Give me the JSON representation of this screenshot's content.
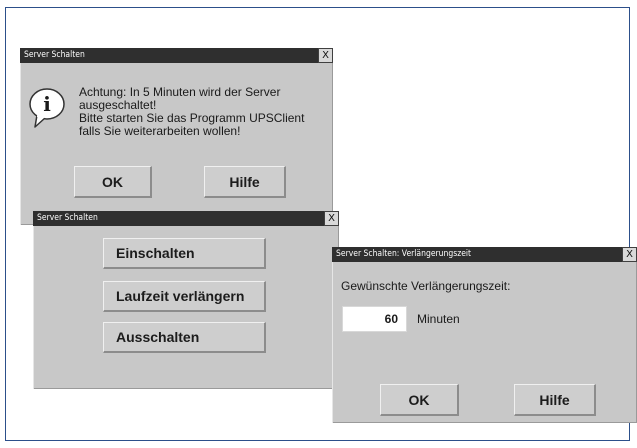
{
  "warning_dialog": {
    "title": "Server Schalten",
    "close_label": "X",
    "icon_glyph": "i",
    "message_lines": [
      "Achtung: In 5 Minuten wird der Server",
      "ausgeschaltet!",
      "Bitte starten Sie das Programm UPSClient",
      "falls Sie weiterarbeiten wollen!"
    ],
    "ok_label": "OK",
    "help_label": "Hilfe"
  },
  "control_dialog": {
    "title": "Server Schalten",
    "close_label": "X",
    "buttons": [
      "Einschalten",
      "Laufzeit verlängern",
      "Ausschalten"
    ]
  },
  "extend_dialog": {
    "title": "Server Schalten: Verlängerungszeit",
    "close_label": "X",
    "prompt": "Gewünschte Verlängerungszeit:",
    "minutes_value": "60",
    "minutes_unit": "Minuten",
    "ok_label": "OK",
    "help_label": "Hilfe"
  }
}
